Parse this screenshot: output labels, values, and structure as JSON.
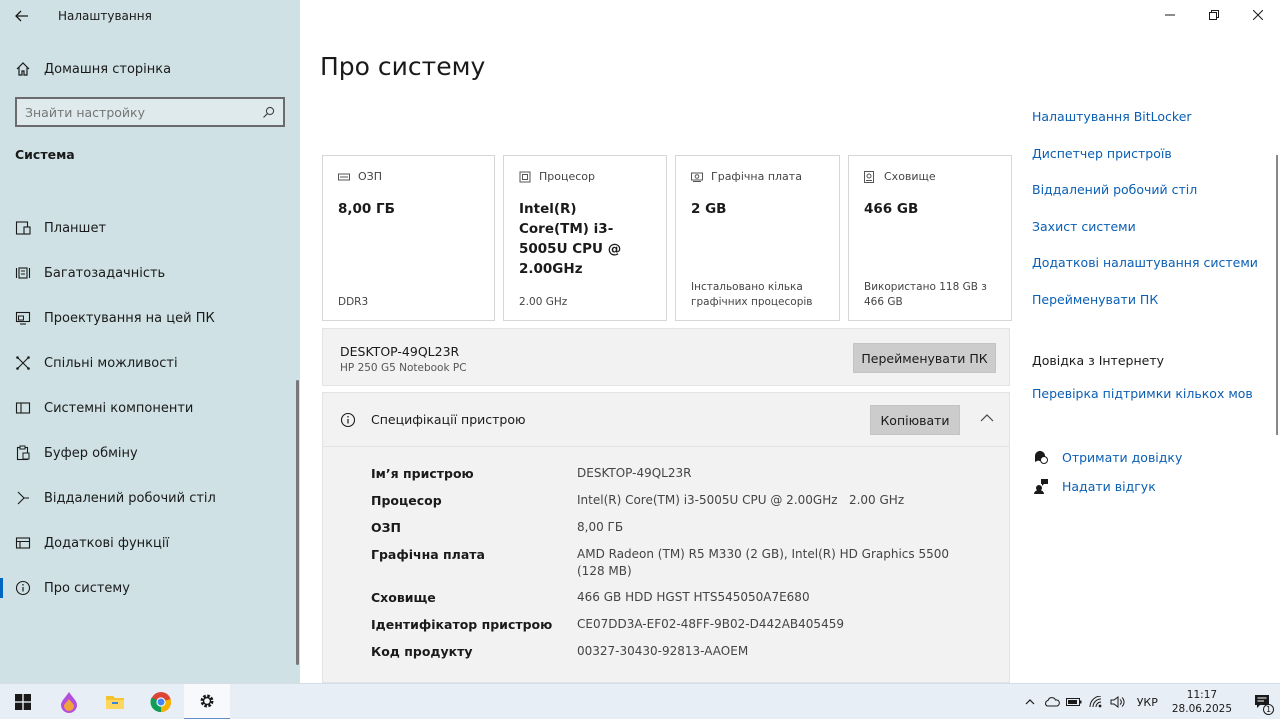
{
  "app": {
    "title": "Налаштування"
  },
  "sidebar": {
    "home": "Домашня сторінка",
    "search_placeholder": "Знайти настройку",
    "section": "Система",
    "items": [
      {
        "label": "Планшет",
        "icon": "tablet-icon"
      },
      {
        "label": "Багатозадачність",
        "icon": "multitasking-icon"
      },
      {
        "label": "Проектування на цей ПК",
        "icon": "projecting-icon"
      },
      {
        "label": "Спільні можливості",
        "icon": "shared-experiences-icon"
      },
      {
        "label": "Системні компоненти",
        "icon": "system-components-icon"
      },
      {
        "label": "Буфер обміну",
        "icon": "clipboard-icon"
      },
      {
        "label": "Віддалений робочий стіл",
        "icon": "remote-desktop-icon"
      },
      {
        "label": "Додаткові функції",
        "icon": "optional-features-icon"
      },
      {
        "label": "Про систему",
        "icon": "info-icon",
        "active": true
      }
    ]
  },
  "main": {
    "title": "Про систему",
    "cards": [
      {
        "label": "ОЗП",
        "value": "8,00 ГБ",
        "footer": "DDR3"
      },
      {
        "label": "Процесор",
        "value": "Intel(R) Core(TM) i3-5005U CPU @ 2.00GHz",
        "footer": "2.00 GHz"
      },
      {
        "label": "Графічна плата",
        "value": "2 GB",
        "footer": "Інстальовано кілька графічних процесорів"
      },
      {
        "label": "Сховище",
        "value": "466 GB",
        "footer": "Використано 118 GB з 466 GB"
      }
    ],
    "device": {
      "name": "DESKTOP-49QL23R",
      "model": "HP 250 G5 Notebook PC",
      "rename_label": "Перейменувати ПК"
    },
    "specs": {
      "title": "Специфікації пристрою",
      "copy_label": "Копіювати",
      "rows": [
        {
          "key": "Ім’я пристрою",
          "value": "DESKTOP-49QL23R"
        },
        {
          "key": "Процесор",
          "value": "Intel(R) Core(TM) i3-5005U CPU @ 2.00GHz   2.00 GHz"
        },
        {
          "key": "ОЗП",
          "value": "8,00 ГБ"
        },
        {
          "key": "Графічна плата",
          "value": "AMD Radeon (TM) R5 M330 (2 GB), Intel(R) HD Graphics 5500 (128 MB)"
        },
        {
          "key": "Сховище",
          "value": "466 GB HDD HGST HTS545050A7E680"
        },
        {
          "key": "Ідентифікатор пристрою",
          "value": "CE07DD3A-EF02-48FF-9B02-D442AB405459"
        },
        {
          "key": "Код продукту",
          "value": "00327-30430-92813-AAOEM"
        }
      ]
    }
  },
  "related": {
    "links": [
      "Налаштування BitLocker",
      "Диспетчер пристроїв",
      "Віддалений робочий стіл",
      "Захист системи",
      "Додаткові налаштування системи",
      "Перейменувати ПК"
    ],
    "help_title": "Довідка з Інтернету",
    "help_link": "Перевірка підтримки кількох мов",
    "get_help": "Отримати довідку",
    "feedback": "Надати відгук"
  },
  "taskbar": {
    "apps": [
      "windows-start-icon",
      "paint-app-icon",
      "file-explorer-icon",
      "chrome-icon",
      "settings-icon"
    ],
    "lang": "УКР",
    "time": "11:17",
    "date": "28.06.2025",
    "notification_count": "1"
  },
  "colors": {
    "sidebar_bg": "#cfe1e4",
    "accent": "#0067c0",
    "link": "#0a5fb4"
  }
}
